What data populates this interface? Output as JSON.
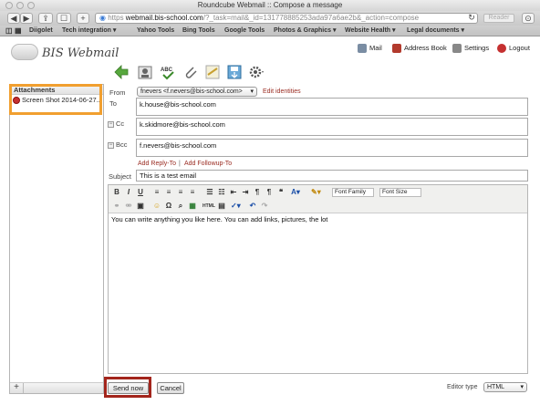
{
  "browser": {
    "window_title": "Roundcube Webmail :: Compose a message",
    "url_scheme": "https",
    "url_domain": "webmail.bis-school.com",
    "url_path": "/?_task=mail&_id=131778885253ada97a6ae2b&_action=compose",
    "reader_label": "Reader",
    "bookmarks": [
      "Diigolet",
      "Tech integration ▾",
      "Yahoo Tools",
      "Bing Tools",
      "Google Tools",
      "Photos & Graphics ▾",
      "Website Health ▾",
      "Legal documents ▾"
    ]
  },
  "header": {
    "logo_text": "BIS Webmail",
    "nav": {
      "mail": "Mail",
      "address_book": "Address Book",
      "settings": "Settings",
      "logout": "Logout"
    }
  },
  "attachments": {
    "title": "Attachments",
    "items": [
      "Screen Shot 2014-06-27..."
    ],
    "add_label": "+"
  },
  "compose": {
    "from_label": "From",
    "from_value": "fnevers <f.nevers@bis-school.com>",
    "edit_identities": "Edit identities",
    "to_label": "To",
    "to_value": "k.house@bis-school.com",
    "cc_label": "Cc",
    "cc_value": "k.skidmore@bis-school.com",
    "bcc_label": "Bcc",
    "bcc_value": "f.nevers@bis-school.com",
    "add_reply_to": "Add Reply-To",
    "separator": "|",
    "add_followup_to": "Add Followup-To",
    "subject_label": "Subject",
    "subject_value": "This is a test email"
  },
  "editor": {
    "font_family": "Font Family",
    "font_size": "Font Size",
    "body": "You can write anything you like here. You can add links, pictures, the lot"
  },
  "footer": {
    "send_label": "Send now",
    "cancel_label": "Cancel",
    "editor_type_label": "Editor type",
    "editor_type_value": "HTML"
  },
  "colors": {
    "highlight_orange": "#f19f2f",
    "highlight_red": "#a3251c",
    "link_red": "#9a2b21"
  }
}
